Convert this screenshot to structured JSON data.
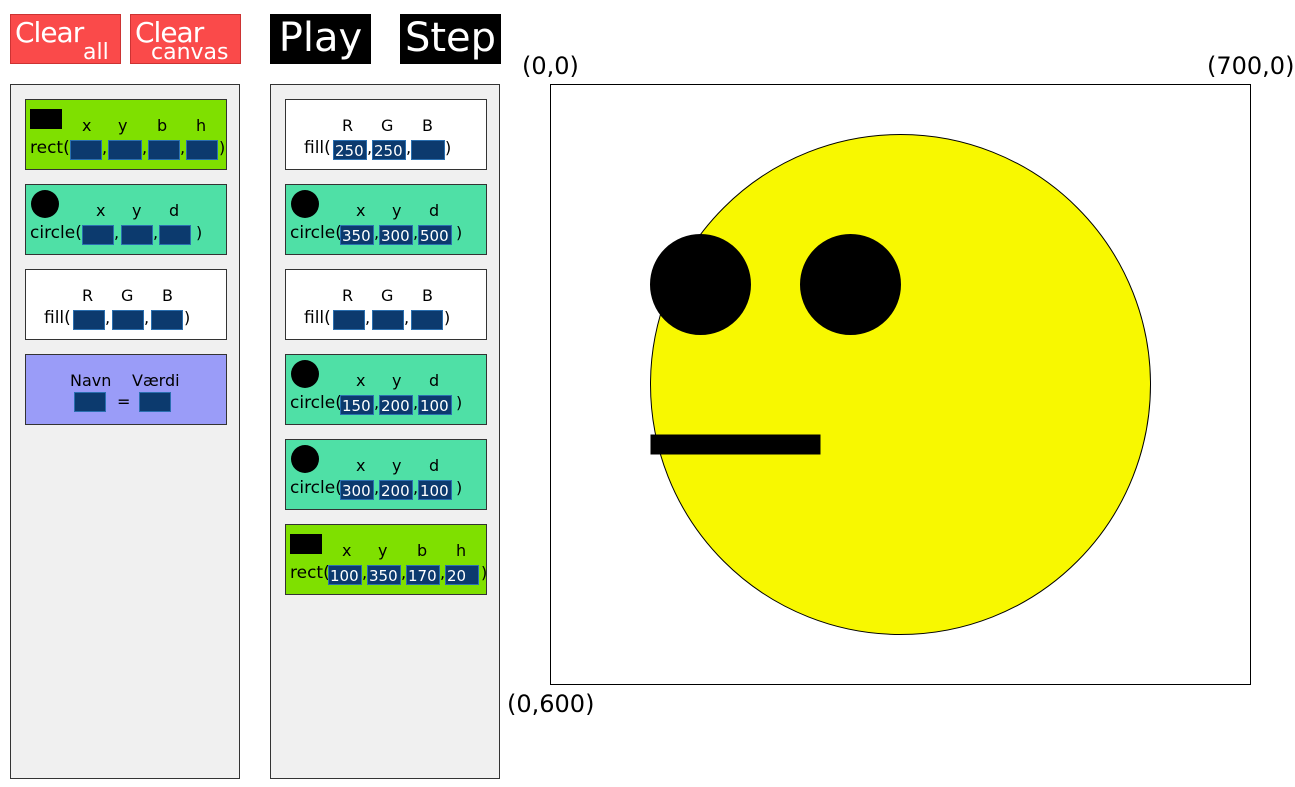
{
  "toolbar": {
    "clear_all": {
      "big": "Clear",
      "small": "all"
    },
    "clear_canvas": {
      "big": "Clear",
      "small": "canvas"
    },
    "play": "Play",
    "step": "Step"
  },
  "palette": {
    "rect": {
      "params": [
        "x",
        "y",
        "b",
        "h"
      ],
      "fn": "rect("
    },
    "circle": {
      "params": [
        "x",
        "y",
        "d"
      ],
      "fn": "circle("
    },
    "fill": {
      "params": [
        "R",
        "G",
        "B"
      ],
      "fn": "fill("
    },
    "variable": {
      "name_label": "Navn",
      "value_label": "Værdi",
      "equals": "="
    }
  },
  "program": [
    {
      "type": "fill",
      "fn": "fill(",
      "params": [
        "R",
        "G",
        "B"
      ],
      "values": [
        "250",
        "250",
        ""
      ]
    },
    {
      "type": "circle",
      "fn": "circle(",
      "params": [
        "x",
        "y",
        "d"
      ],
      "values": [
        "350",
        "300",
        "500"
      ]
    },
    {
      "type": "fill",
      "fn": "fill(",
      "params": [
        "R",
        "G",
        "B"
      ],
      "values": [
        "",
        "",
        ""
      ]
    },
    {
      "type": "circle",
      "fn": "circle(",
      "params": [
        "x",
        "y",
        "d"
      ],
      "values": [
        "150",
        "200",
        "100"
      ]
    },
    {
      "type": "circle",
      "fn": "circle(",
      "params": [
        "x",
        "y",
        "d"
      ],
      "values": [
        "300",
        "200",
        "100"
      ]
    },
    {
      "type": "rect",
      "fn": "rect(",
      "params": [
        "x",
        "y",
        "b",
        "h"
      ],
      "values": [
        "100",
        "350",
        "170",
        "20"
      ]
    }
  ],
  "canvas": {
    "origin_label": "(0,0)",
    "top_right_label": "(700,0)",
    "bottom_left_label": "(0,600)",
    "background": "#ffffff",
    "face_color": "#f8f800",
    "feature_color": "#000000"
  }
}
